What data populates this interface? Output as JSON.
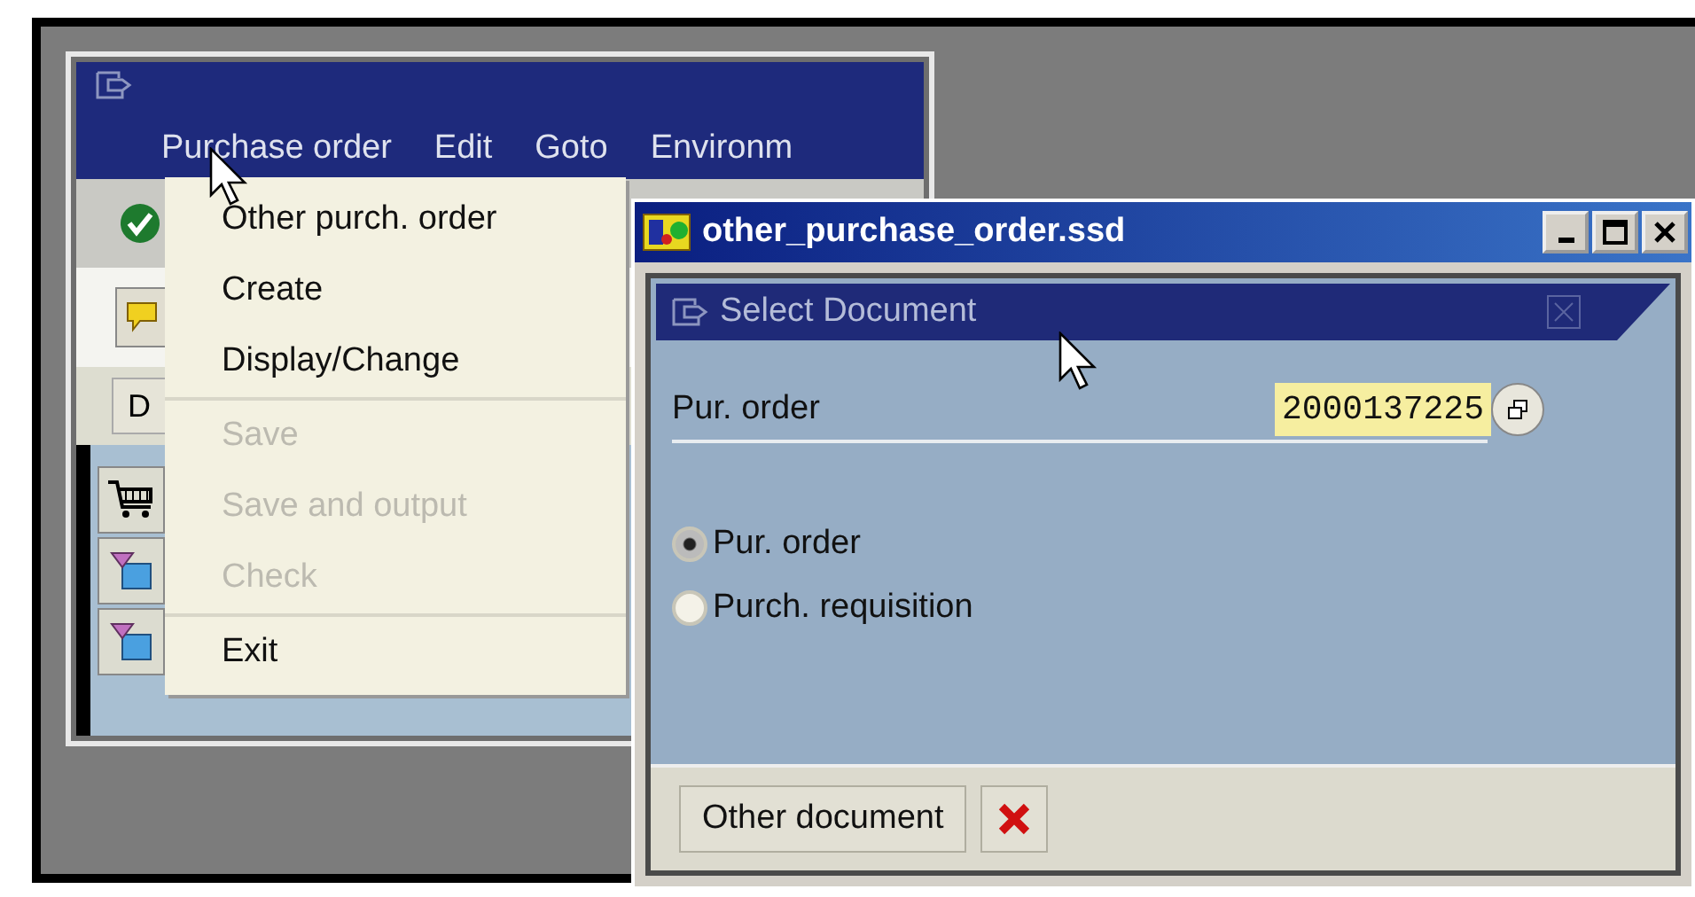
{
  "main_window": {
    "menu_bar": [
      "Purchase order",
      "Edit",
      "Goto",
      "Environm"
    ],
    "toolbar_button": "D"
  },
  "menu": {
    "groups": [
      {
        "items": [
          {
            "label": "Other purch. order",
            "disabled": false
          },
          {
            "label": "Create",
            "disabled": false
          },
          {
            "label": "Display/Change",
            "disabled": false
          }
        ]
      },
      {
        "items": [
          {
            "label": "Save",
            "disabled": true
          },
          {
            "label": "Save and output",
            "disabled": true
          },
          {
            "label": "Check",
            "disabled": true
          }
        ]
      },
      {
        "items": [
          {
            "label": "Exit",
            "disabled": false
          }
        ]
      }
    ]
  },
  "dialog": {
    "title": "other_purchase_order.ssd",
    "header": "Select Document",
    "field": {
      "label": "Pur. order",
      "value": "2000137225"
    },
    "options": [
      {
        "label": "Pur. order",
        "selected": true
      },
      {
        "label": "Purch. requisition",
        "selected": false
      }
    ],
    "buttons": [
      {
        "kind": "text",
        "label": "Other document"
      },
      {
        "kind": "cancel"
      }
    ]
  }
}
